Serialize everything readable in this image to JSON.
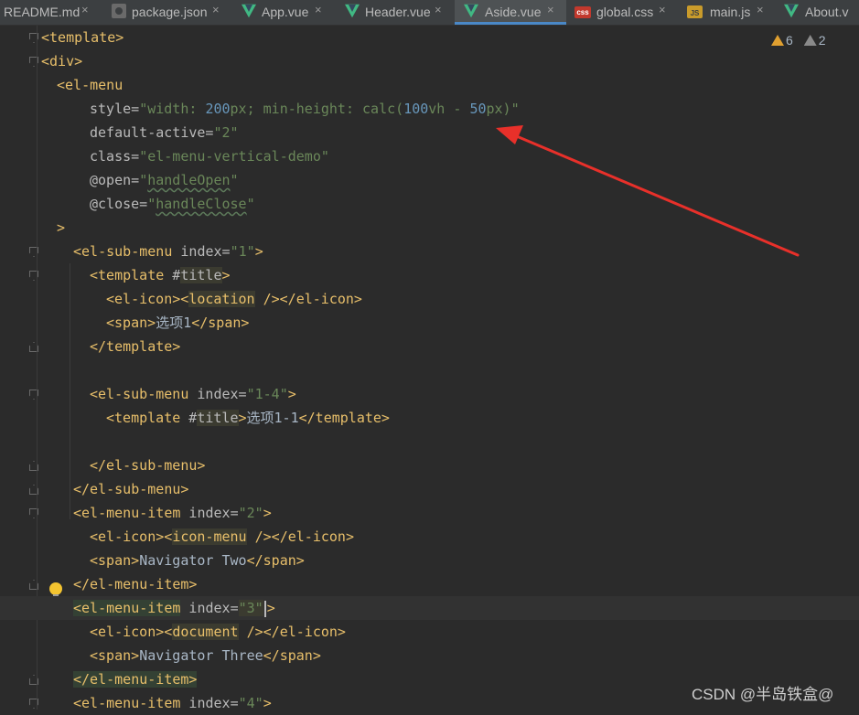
{
  "tabs": [
    {
      "label": "README.md",
      "icon": "close-icon"
    },
    {
      "label": "package.json",
      "icon": "json-file-icon"
    },
    {
      "label": "App.vue",
      "icon": "vue-file-icon"
    },
    {
      "label": "Header.vue",
      "icon": "vue-file-icon"
    },
    {
      "label": "Aside.vue",
      "icon": "vue-file-icon",
      "active": true
    },
    {
      "label": "global.css",
      "icon": "css-file-icon"
    },
    {
      "label": "main.js",
      "icon": "js-file-icon"
    },
    {
      "label": "About.v",
      "icon": "vue-file-icon"
    }
  ],
  "tab_close_glyph": "×",
  "icon_texts": {
    "css": "css",
    "js": "JS"
  },
  "inspection": {
    "warnings": "6",
    "weak_warnings": "2"
  },
  "colors": {
    "background": "#2b2b2b",
    "tag": "#e8bf6a",
    "string": "#6a8759",
    "number": "#6897bb",
    "arrow": "#e8302a",
    "active_tab_underline": "#4a88c7"
  },
  "code": {
    "l1_tag": "<template>",
    "l2_tag": "<div>",
    "l3_tag": "<el-menu",
    "l4_attr": "style=",
    "l4_s1": "\"width: ",
    "l4_n1": "200",
    "l4_s2": "px; min-height: calc(",
    "l4_n2": "100",
    "l4_s3": "vh - ",
    "l4_n3": "50",
    "l4_s4": "px)\"",
    "l5_attr": "default-active=",
    "l5_str": "\"2\"",
    "l6_attr": "class=",
    "l6_str": "\"el-menu-vertical-demo\"",
    "l7_attr": "@open=",
    "l7_q1": "\"",
    "l7_val": "handleOpen",
    "l7_q2": "\"",
    "l8_attr": "@close=",
    "l8_q1": "\"",
    "l8_val": "handleClose",
    "l8_q2": "\"",
    "l9_tag": ">",
    "l10_tag": "<el-sub-menu",
    "l10_attr": " index=",
    "l10_str": "\"1\"",
    "l10_end": ">",
    "l11_tag": "<template",
    "l11_attr": " #",
    "l11_hl": "title",
    "l11_end": ">",
    "l12_t1": "<el-icon><",
    "l12_hl": "location",
    "l12_t2": " /></el-icon>",
    "l13_t1": "<span>",
    "l13_text": "选项1",
    "l13_t2": "</span>",
    "l14_tag": "</template>",
    "l16_tag": "<el-sub-menu",
    "l16_attr": " index=",
    "l16_str": "\"1-4\"",
    "l16_end": ">",
    "l17_tag": "<template",
    "l17_attr": " #",
    "l17_hl": "title",
    "l17_end": ">",
    "l17_text": "选项1-1",
    "l17_close": "</template>",
    "l19_tag": "</el-sub-menu>",
    "l20_tag": "</el-sub-menu>",
    "l21_tag": "<el-menu-item",
    "l21_attr": " index=",
    "l21_str": "\"2\"",
    "l21_end": ">",
    "l22_t1": "<el-icon><",
    "l22_hl": "icon-menu",
    "l22_t2": " /></el-icon>",
    "l23_t1": "<span>",
    "l23_text": "Navigator Two",
    "l23_t2": "</span>",
    "l24_tag": "</el-menu-item>",
    "l25_tag": "<el-menu-item",
    "l25_attr": " index=",
    "l25_str": "\"3\"",
    "l25_end": ">",
    "l26_t1": "<el-icon><",
    "l26_hl": "document",
    "l26_t2": " /></el-icon>",
    "l27_t1": "<span>",
    "l27_text": "Navigator Three",
    "l27_t2": "</span>",
    "l28_tag": "</el-menu-item>",
    "l29_tag": "<el-menu-item",
    "l29_attr": " index=",
    "l29_str": "\"4\"",
    "l29_end": ">"
  },
  "watermark": "CSDN @半岛铁盒@"
}
